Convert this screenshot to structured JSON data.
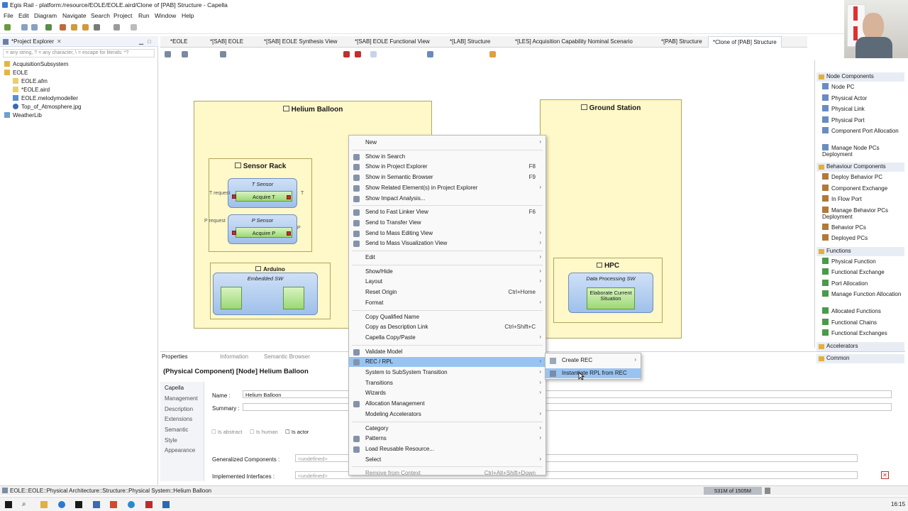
{
  "window": {
    "title": "Egis Rail - platform:/resource/EOLE/EOLE.aird/Clone of [PAB] Structure - Capella"
  },
  "menubar": [
    "File",
    "Edit",
    "Diagram",
    "Navigate",
    "Search",
    "Project",
    "Run",
    "Window",
    "Help"
  ],
  "explorer": {
    "title": "*Project Explorer",
    "filter_placeholder": "= any string, ? = any character, \\ = escape for literals: *?",
    "tree": [
      {
        "label": "AcquisitionSubsystem",
        "level": 0
      },
      {
        "label": "EOLE",
        "level": 0
      },
      {
        "label": "EOLE.afm",
        "level": 1
      },
      {
        "label": "*EOLE.aird",
        "level": 1
      },
      {
        "label": "EOLE.melodymodeller",
        "level": 1
      },
      {
        "label": "Top_of_Atmosphere.jpg",
        "level": 1
      },
      {
        "label": "WeatherLib",
        "level": 0
      }
    ]
  },
  "tabs": [
    {
      "label": "*EOLE"
    },
    {
      "label": "*[SAB] EOLE"
    },
    {
      "label": "*[SAB] EOLE Synthesis View"
    },
    {
      "label": "*[SAB] EOLE Functional View"
    },
    {
      "label": "*[LAB] Structure"
    },
    {
      "label": "*[LES] Acquisition Capability Nominal Scenario"
    },
    {
      "label": "*[PAB] Structure"
    },
    {
      "label": "*Clone of [PAB] Structure",
      "active": true
    }
  ],
  "diagram": {
    "helium_balloon": "Helium Balloon",
    "ground_station": "Ground Station",
    "sensor_rack": "Sensor Rack",
    "t_sensor": "T Sensor",
    "p_sensor": "P Sensor",
    "acquire_t": "Acquire T",
    "acquire_p": "Acquire P",
    "arduino": "Arduino",
    "embedded_sw": "Embedded SW",
    "hpc": "HPC",
    "data_processing_sw": "Data Processing SW",
    "elaborate": "Elaborate Current Situation",
    "t_request": "T request",
    "p_request": "P request",
    "t_label": "T",
    "p_label": "P"
  },
  "context_menu": {
    "items": [
      {
        "label": "New",
        "arrow": true
      },
      {
        "sep": true
      },
      {
        "label": "Show in Search",
        "icon": "search-icon"
      },
      {
        "label": "Show in Project Explorer",
        "shortcut": "F8",
        "icon": "explorer-icon"
      },
      {
        "label": "Show in Semantic Browser",
        "shortcut": "F9",
        "icon": "browser-icon"
      },
      {
        "label": "Show Related Element(s) in Project Explorer",
        "arrow": true,
        "icon": "related-icon"
      },
      {
        "label": "Show Impact Analysis...",
        "icon": "impact-icon"
      },
      {
        "sep": true
      },
      {
        "label": "Send to Fast Linker View",
        "shortcut": "F6",
        "icon": "linker-icon"
      },
      {
        "label": "Send to Transfer View",
        "icon": "transfer-icon"
      },
      {
        "label": "Send to Mass Editing View",
        "arrow": true,
        "icon": "mass-edit-icon"
      },
      {
        "label": "Send to Mass Visualization View",
        "arrow": true,
        "icon": "mass-vis-icon"
      },
      {
        "sep": true
      },
      {
        "label": "Edit",
        "arrow": true
      },
      {
        "sep": true
      },
      {
        "label": "Show/Hide",
        "arrow": true
      },
      {
        "label": "Layout",
        "arrow": true
      },
      {
        "label": "Reset Origin",
        "shortcut": "Ctrl+Home"
      },
      {
        "label": "Format",
        "arrow": true
      },
      {
        "sep": true
      },
      {
        "label": "Copy Qualified Name"
      },
      {
        "label": "Copy as Description Link",
        "shortcut": "Ctrl+Shift+C"
      },
      {
        "label": "Capella Copy/Paste",
        "arrow": true
      },
      {
        "sep": true
      },
      {
        "label": "Validate Model",
        "icon": "validate-icon"
      },
      {
        "label": "REC / RPL",
        "arrow": true,
        "selected": true,
        "icon": "rec-icon"
      },
      {
        "label": "System to SubSystem Transition",
        "arrow": true
      },
      {
        "label": "Transitions",
        "arrow": true
      },
      {
        "label": "Wizards",
        "arrow": true
      },
      {
        "label": "Allocation Management",
        "icon": "allocation-icon"
      },
      {
        "label": "Modeling Accelerators",
        "arrow": true
      },
      {
        "sep": true
      },
      {
        "label": "Category",
        "arrow": true
      },
      {
        "label": "Patterns",
        "arrow": true,
        "icon": "patterns-icon"
      },
      {
        "label": "Load Reusable Resource...",
        "icon": "load-icon"
      },
      {
        "label": "Select",
        "arrow": true
      },
      {
        "sep": true
      },
      {
        "label": "Remove from Context",
        "shortcut": "Ctrl+Alt+Shift+Down",
        "disabled": true
      }
    ]
  },
  "submenu": {
    "items": [
      {
        "label": "Create REC",
        "arrow": true
      },
      {
        "label": "Instantiate RPL from REC",
        "selected": true
      }
    ]
  },
  "palette": {
    "groups": [
      {
        "label": "Node Components",
        "items": [
          "Node PC",
          "Physical Actor",
          "Physical Link",
          "Physical Port",
          "Component Port Allocation",
          "Manage Node PCs Deployment"
        ]
      },
      {
        "label": "Behaviour Components",
        "items": [
          "Deploy Behavior PC",
          "Component Exchange",
          "In Flow Port",
          "Manage Behavior PCs Deployment",
          "Behavior PCs",
          "Deployed PCs"
        ]
      },
      {
        "label": "Functions",
        "items": [
          "Physical Function",
          "Functional Exchange",
          "Port Allocation",
          "Manage Function Allocation",
          "Allocated Functions",
          "Functional Chains",
          "Functional Exchanges"
        ]
      },
      {
        "label": "Accelerators",
        "items": []
      },
      {
        "label": "Common",
        "items": []
      }
    ]
  },
  "properties": {
    "tabs": [
      "Properties",
      "Information",
      "Semantic Browser"
    ],
    "heading": "(Physical Component) [Node] Helium Balloon",
    "sidebar": [
      "Capella",
      "Management",
      "Description",
      "Extensions",
      "Semantic",
      "Style",
      "Appearance"
    ],
    "name_label": "Name :",
    "name_value": "Helium Balloon",
    "summary_label": "Summary :",
    "checks": [
      "Is abstract",
      "Is human",
      "Is actor"
    ],
    "generalized_label": "Generalized Components :",
    "implemented_label": "Implemented Interfaces :",
    "undefined": "<undefined>"
  },
  "status": {
    "path": "EOLE::EOLE::Physical Architecture::Structure::Physical System::Helium Balloon",
    "memory": "531M of 1505M"
  },
  "taskbar": {
    "time": "16:15"
  },
  "colors": {
    "selection": "#99c4f1",
    "node_fill": "#fff8c8",
    "function_fill": "#9cd876"
  }
}
